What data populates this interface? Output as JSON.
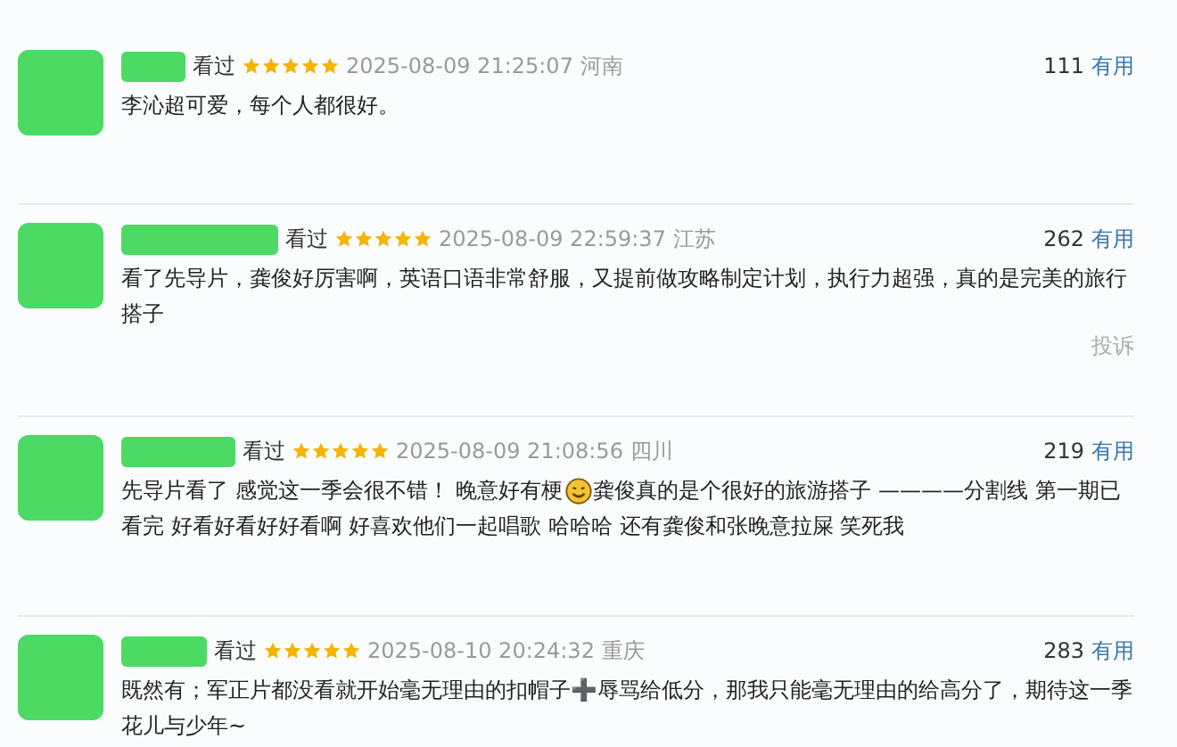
{
  "comments": [
    {
      "status": "看过",
      "stars": 5,
      "time": "2025-08-09 21:25:07",
      "location": "河南",
      "votes": "111",
      "vote_label": "有用",
      "body": [
        {
          "kind": "text",
          "text": "李沁超可爱，每个人都很好。"
        }
      ]
    },
    {
      "status": "看过",
      "stars": 5,
      "time": "2025-08-09 22:59:37",
      "location": "江苏",
      "votes": "262",
      "vote_label": "有用",
      "body": [
        {
          "kind": "text",
          "text": "看了先导片，龚俊好厉害啊，英语口语非常舒服，又提前做攻略制定计划，执行力超强，真的是完美的旅行搭子"
        }
      ],
      "report": "投诉"
    },
    {
      "status": "看过",
      "stars": 5,
      "time": "2025-08-09 21:08:56",
      "location": "四川",
      "votes": "219",
      "vote_label": "有用",
      "body": [
        {
          "kind": "text",
          "text": "先导片看了 感觉这一季会很不错！  晚意好有梗"
        },
        {
          "kind": "emoji"
        },
        {
          "kind": "text",
          "text": "龚俊真的是个很好的旅游搭子 ————分割线 第一期已"
        },
        {
          "kind": "text",
          "text": "看完 好看好看好好看啊 好喜欢他们一起唱歌 哈哈哈 还有龚俊和张晚意拉屎 笑死我"
        }
      ]
    },
    {
      "status": "看过",
      "stars": 5,
      "time": "2025-08-10 20:24:32",
      "location": "重庆",
      "votes": "283",
      "vote_label": "有用",
      "body": [
        {
          "kind": "text",
          "text": "既然有；军正片都没看就开始毫无理由的扣帽子➕辱骂给低分，那我只能毫无理由的给高分了，期待这一季花儿与少年~"
        }
      ]
    }
  ]
}
